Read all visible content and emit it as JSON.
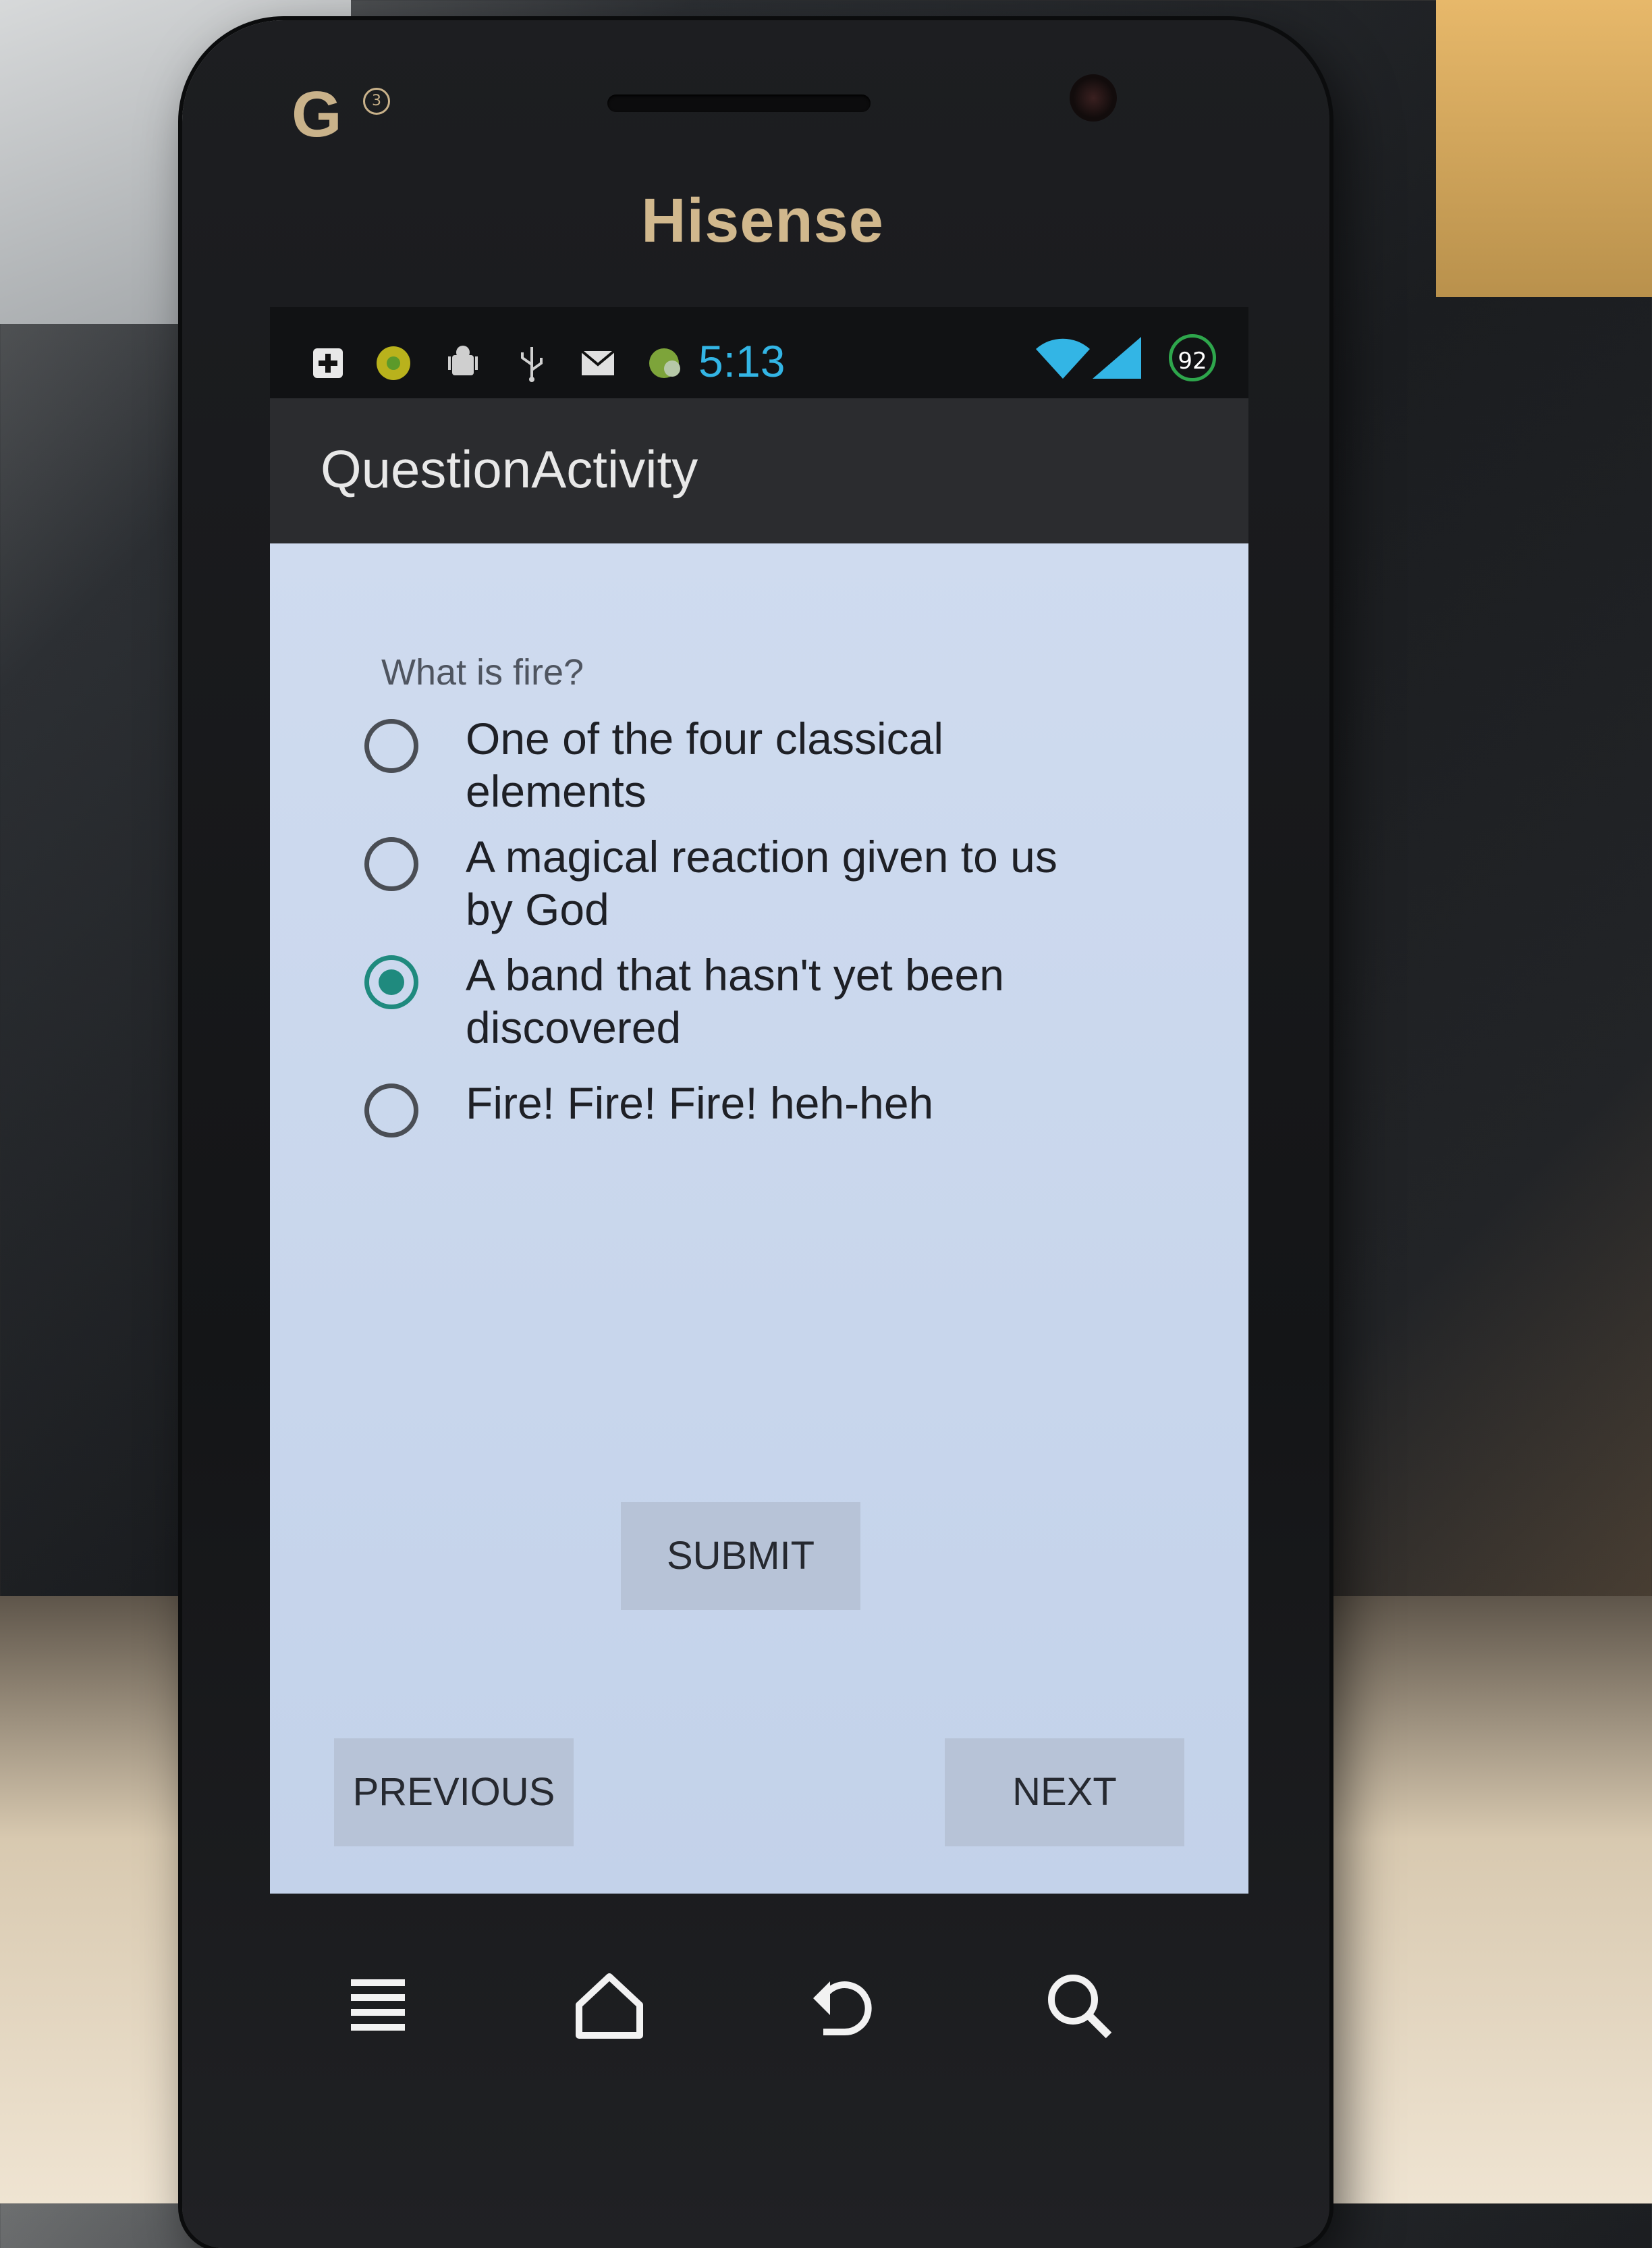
{
  "device": {
    "brand": "Hisense",
    "carrier_logo": "G",
    "carrier_logo_sup": "3"
  },
  "status_bar": {
    "icons": [
      "add-icon",
      "app-icon",
      "android-debug-icon",
      "usb-icon",
      "mail-icon",
      "sync-icon",
      "wifi-icon",
      "signal-icon"
    ],
    "time": "5:13",
    "battery": "92",
    "accent_color": "#33b5e5"
  },
  "app": {
    "title": "QuestionActivity"
  },
  "quiz": {
    "question": "What is fire?",
    "options": [
      {
        "label": "One of the four classical elements",
        "selected": false
      },
      {
        "label": "A magical reaction given to us by God",
        "selected": false
      },
      {
        "label": "A band that hasn't yet been discovered",
        "selected": true
      },
      {
        "label": "Fire! Fire! Fire! heh-heh",
        "selected": false
      }
    ],
    "submit_label": "SUBMIT",
    "previous_label": "PREVIOUS",
    "next_label": "NEXT",
    "radio_color": "#1f8a7e"
  },
  "nav_keys": [
    "menu-icon",
    "home-icon",
    "back-icon",
    "search-icon"
  ]
}
